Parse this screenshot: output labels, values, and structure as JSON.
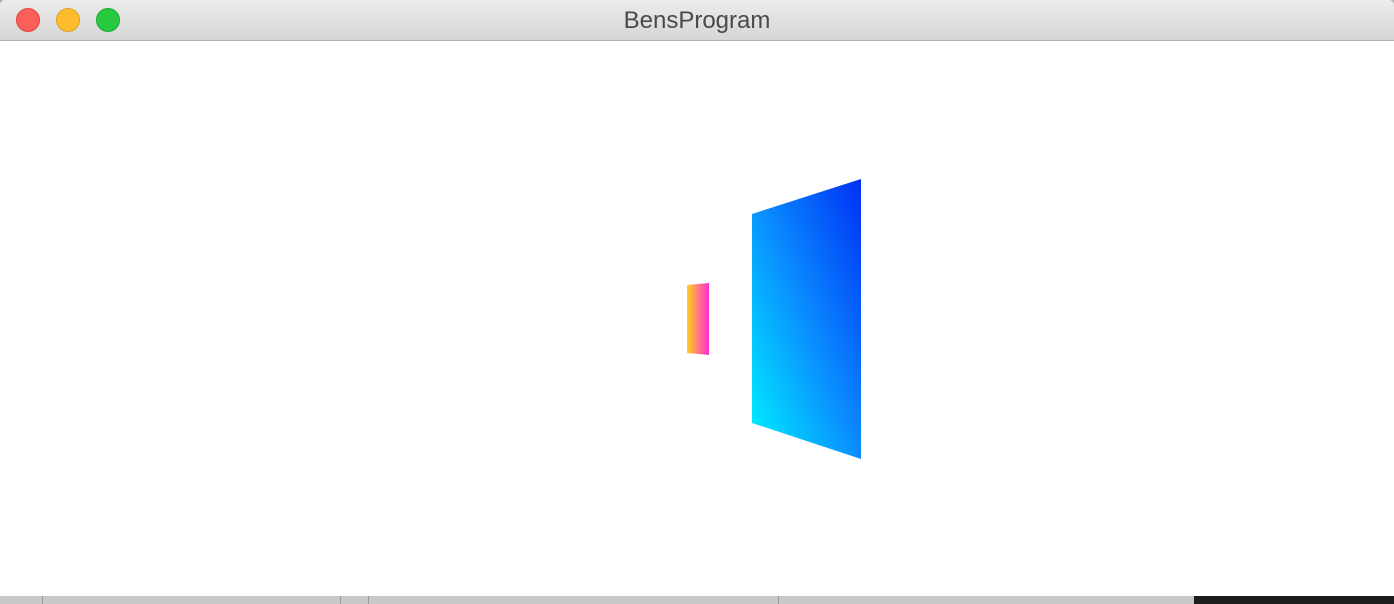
{
  "window": {
    "title": "BensProgram"
  },
  "traffic_lights": {
    "close": "close-button",
    "minimize": "minimize-button",
    "zoom": "zoom-button"
  },
  "scene": {
    "small_quad_colors": [
      "#ffd21a",
      "#ff2ad9"
    ],
    "large_quad_colors": [
      "#00f4ff",
      "#0a8cff",
      "#0030f5"
    ]
  }
}
